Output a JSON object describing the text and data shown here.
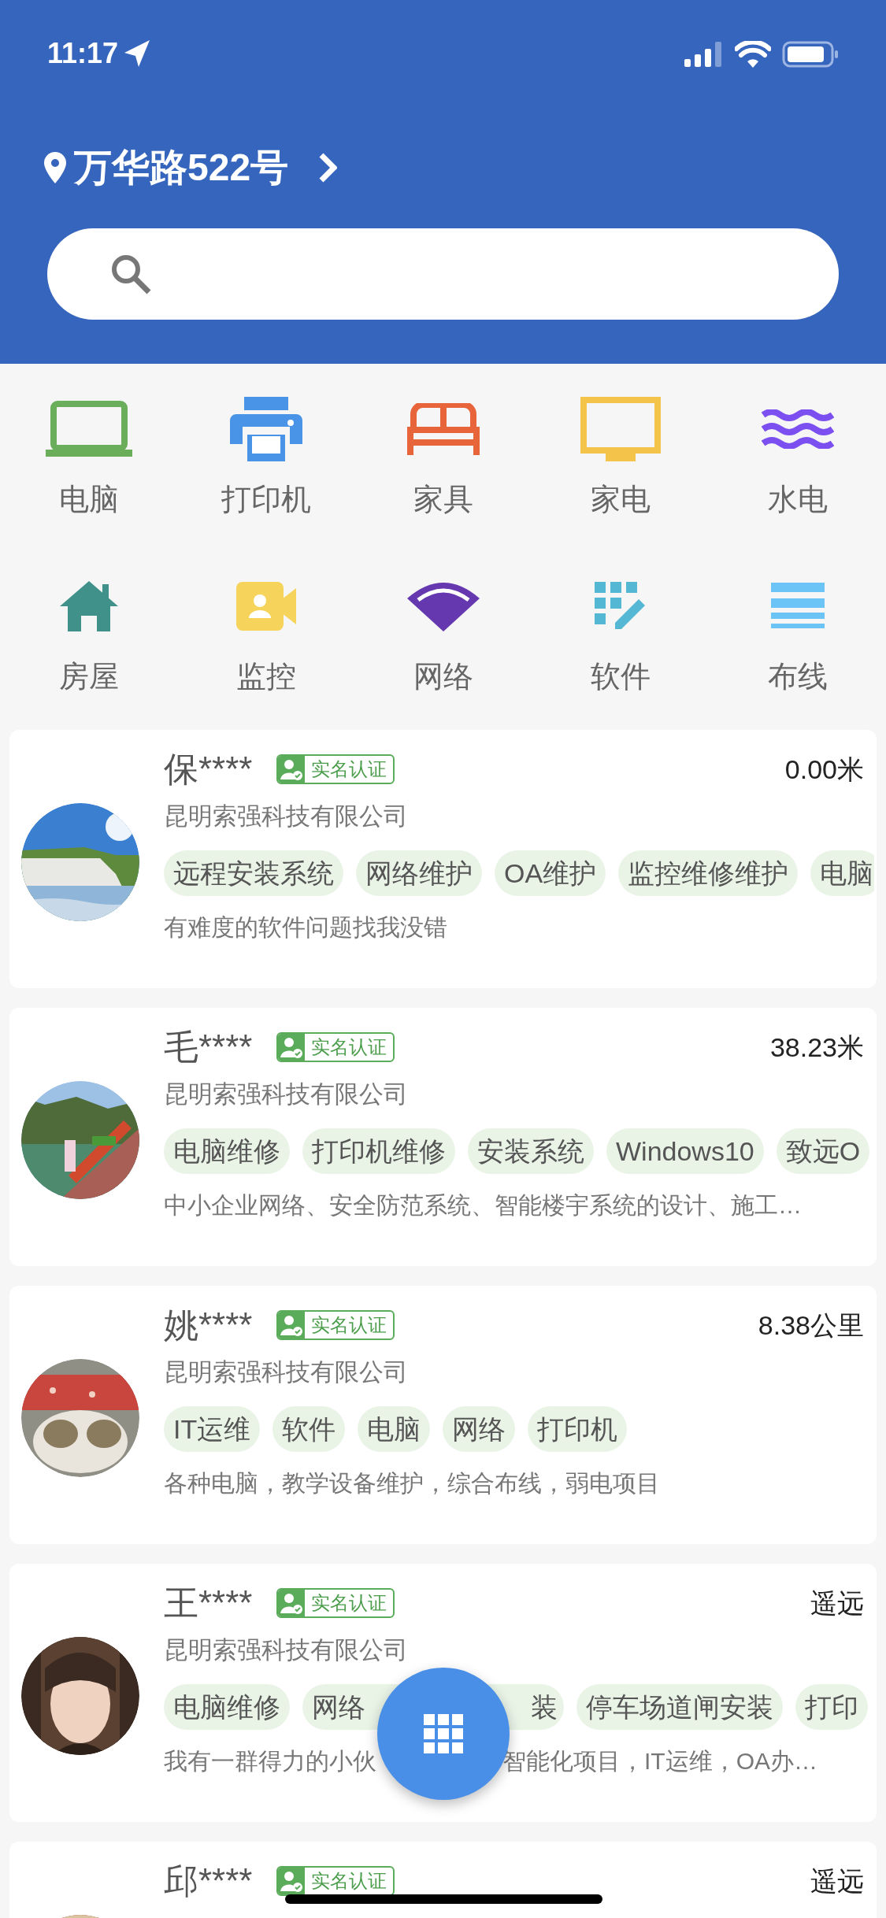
{
  "status_bar": {
    "time": "11:17"
  },
  "header": {
    "address": "万华路522号"
  },
  "categories": [
    {
      "label": "电脑",
      "kind": "laptop"
    },
    {
      "label": "打印机",
      "kind": "printer"
    },
    {
      "label": "家具",
      "kind": "bed"
    },
    {
      "label": "家电",
      "kind": "monitor"
    },
    {
      "label": "水电",
      "kind": "waves"
    },
    {
      "label": "房屋",
      "kind": "house"
    },
    {
      "label": "监控",
      "kind": "camera"
    },
    {
      "label": "网络",
      "kind": "signal"
    },
    {
      "label": "软件",
      "kind": "grid-pencil"
    },
    {
      "label": "布线",
      "kind": "lines"
    }
  ],
  "providers": [
    {
      "name": "保****",
      "badge": "实名认证",
      "distance": "0.00米",
      "company": "昆明索强科技有限公司",
      "tags": [
        {
          "text": "远程安装系统"
        },
        {
          "text": "网络维护"
        },
        {
          "text": "OA维护"
        },
        {
          "text": "监控维修维护"
        },
        {
          "text": "电脑"
        }
      ],
      "description": [
        "有难度的软件问题找我没错"
      ],
      "avatar": {
        "kind": "picture"
      }
    },
    {
      "name": "毛****",
      "badge": "实名认证",
      "distance": "38.23米",
      "company": "昆明索强科技有限公司",
      "tags": [
        {
          "text": "电脑维修"
        },
        {
          "text": "打印机维修"
        },
        {
          "text": "安装系统"
        },
        {
          "text": "Windows10"
        },
        {
          "text": "致远O"
        }
      ],
      "description": [
        "中小企业网络、安全防范系统、智能楼宇系统的设计、施工…"
      ],
      "avatar": {
        "kind": "picture"
      }
    },
    {
      "name": "姚****",
      "badge": "实名认证",
      "distance": "8.38公里",
      "company": "昆明索强科技有限公司",
      "tags": [
        {
          "text": "IT运维"
        },
        {
          "text": "软件"
        },
        {
          "text": "电脑"
        },
        {
          "text": "网络"
        },
        {
          "text": "打印机"
        }
      ],
      "description": [
        "各种电脑，教学设备维护，综合布线，弱电项目"
      ],
      "avatar": {
        "kind": "picture"
      }
    },
    {
      "name": "王****",
      "badge": "实名认证",
      "distance": "遥远",
      "company": "昆明索强科技有限公司",
      "tags": [
        {
          "text": "电脑维修",
          "kind": "full"
        },
        {
          "text": "网络",
          "kind": "clipped-end"
        },
        {
          "text": "装",
          "kind": "clipped-start"
        },
        {
          "text": "停车场道闸安装",
          "kind": "full"
        },
        {
          "text": "打印",
          "kind": "full"
        }
      ],
      "description": [
        "我有一群得力的小伙",
        "智能化项目，IT运维，OA办…"
      ],
      "avatar": {
        "kind": "picture"
      }
    },
    {
      "name": "邱****",
      "badge": "实名认证",
      "distance": "遥远",
      "avatar": {
        "kind": "picture"
      }
    }
  ]
}
